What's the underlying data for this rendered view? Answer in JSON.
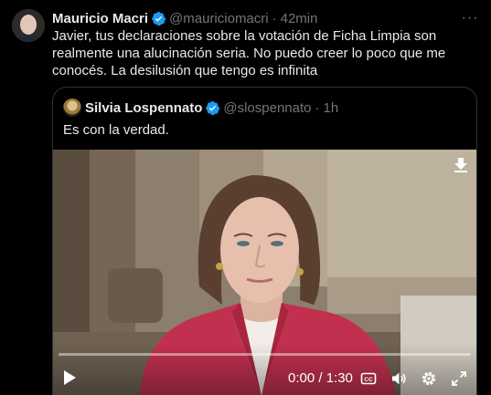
{
  "tweet": {
    "author_name": "Mauricio Macri",
    "author_handle": "@mauriciomacri",
    "separator": "·",
    "time": "42min",
    "more_label": "···",
    "text": "Javier, tus declaraciones sobre la votación de Ficha Limpia son realmente una alucinación seria. No puedo creer lo poco que me conocés. La desilusión que tengo es infinita"
  },
  "quote": {
    "author_name": "Silvia Lospennato",
    "author_handle": "@slospennato",
    "separator": "·",
    "time": "1h",
    "text": "Es con la verdad."
  },
  "video": {
    "timecode": "0:00 / 1:30",
    "progress": 0.0,
    "controls": [
      "play-icon",
      "captions-icon",
      "volume-icon",
      "settings-icon",
      "fullscreen-icon"
    ]
  },
  "colors": {
    "background": "#000000",
    "text": "#e7e9ea",
    "muted": "#71767b",
    "verified": "#1d9bf0",
    "border": "#2f3336"
  }
}
